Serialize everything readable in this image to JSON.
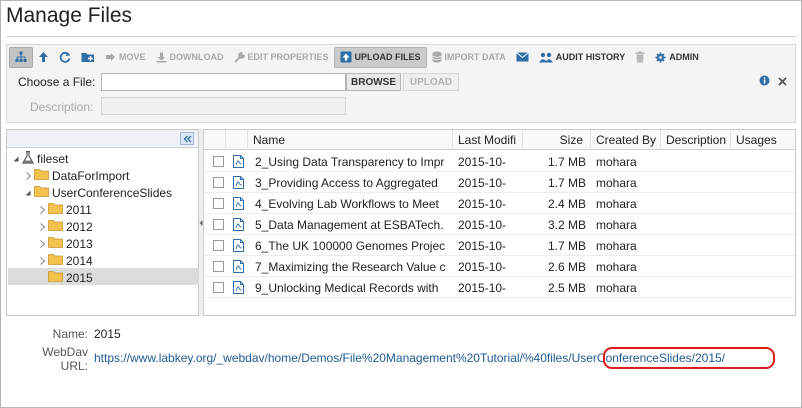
{
  "page": {
    "title": "Manage Files"
  },
  "toolbar": {
    "move": "MOVE",
    "download": "DOWNLOAD",
    "edit_properties": "EDIT PROPERTIES",
    "upload_files": "UPLOAD FILES",
    "import_data": "IMPORT DATA",
    "audit_history": "AUDIT HISTORY",
    "admin": "ADMIN"
  },
  "upload": {
    "choose_label": "Choose a File:",
    "choose_value": "",
    "browse": "BROWSE",
    "upload": "UPLOAD",
    "description_label": "Description:",
    "description_value": ""
  },
  "tree": {
    "root": "fileset",
    "nodes": [
      "DataForImport",
      "UserConferenceSlides",
      "2011",
      "2012",
      "2013",
      "2014",
      "2015"
    ],
    "selected": "2015"
  },
  "grid": {
    "columns": [
      "Name",
      "Last Modifi",
      "Size",
      "Created By",
      "Description",
      "Usages"
    ],
    "rows": [
      {
        "name": "2_Using Data Transparency to Impr",
        "modified": "2015-10-",
        "size": "1.7 MB",
        "created_by": "mohara"
      },
      {
        "name": "3_Providing Access to Aggregated",
        "modified": "2015-10-",
        "size": "1.7 MB",
        "created_by": "mohara"
      },
      {
        "name": "4_Evolving Lab Workflows to Meet",
        "modified": "2015-10-",
        "size": "2.4 MB",
        "created_by": "mohara"
      },
      {
        "name": "5_Data Management at ESBATech.",
        "modified": "2015-10-",
        "size": "3.2 MB",
        "created_by": "mohara"
      },
      {
        "name": "6_The UK 100000 Genomes Projec",
        "modified": "2015-10-",
        "size": "1.7 MB",
        "created_by": "mohara"
      },
      {
        "name": "7_Maximizing the Research Value c",
        "modified": "2015-10-",
        "size": "2.6 MB",
        "created_by": "mohara"
      },
      {
        "name": "9_Unlocking Medical Records with",
        "modified": "2015-10-",
        "size": "2.5 MB",
        "created_by": "mohara"
      }
    ]
  },
  "details": {
    "name_label": "Name:",
    "name_value": "2015",
    "webdav_label_1": "WebDav",
    "webdav_label_2": "URL:",
    "url_prefix": "https://www.labkey.org/_webdav/home/Demos/File%20Management%20Tutorial/%40files/",
    "url_highlight": "UserConferenceSlides/2015/"
  },
  "colors": {
    "highlight": "#e01b1b",
    "link": "#1e5a94",
    "folder": "#f2c14e",
    "selection": "#dcdcdc"
  },
  "icons": [
    "tree-icon",
    "up-arrow-icon",
    "refresh-icon",
    "new-folder-icon",
    "move-icon",
    "download-icon",
    "wrench-icon",
    "upload-icon",
    "database-icon",
    "envelope-icon",
    "users-icon",
    "trash-icon",
    "gear-icon",
    "info-icon",
    "close-icon",
    "collapse-icon",
    "flask-icon",
    "folder-icon",
    "pdf-file-icon"
  ]
}
